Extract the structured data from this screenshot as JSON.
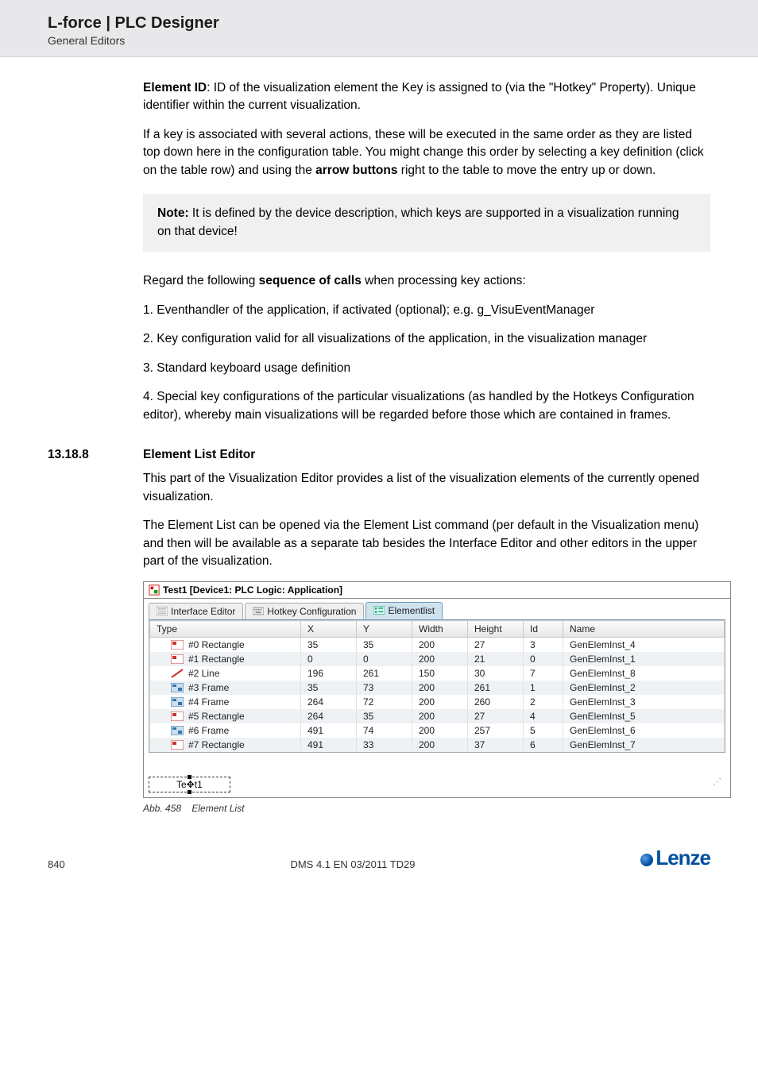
{
  "header": {
    "title": "L-force | PLC Designer",
    "subtitle": "General Editors"
  },
  "para": {
    "p1a": "Element ID",
    "p1b": ": ID of the visualization element the Key is assigned to (via the \"Hotkey\" Property). Unique identifier within the current visualization.",
    "p2a": "If a key is associated with several actions, these will be executed in the same order as they are listed top down here in the configuration table. You might change this order by selecting a key definition (click on the table row) and using the ",
    "p2b": "arrow buttons",
    "p2c": " right to the table to move the entry up or down.",
    "note_a": "Note:",
    "note_b": " It is defined by the device description, which keys are supported in a visualization running on that device!",
    "p3a": "Regard the following ",
    "p3b": "sequence of calls",
    "p3c": " when processing key actions:",
    "li1": "1. Eventhandler of the application, if activated (optional); e.g. g_VisuEventManager",
    "li2": "2. Key configuration valid for all visualizations of the application, in the visualization manager",
    "li3": "3. Standard keyboard usage definition",
    "li4": "4. Special key configurations of the particular visualizations (as handled by the Hotkeys Configuration editor), whereby main visualizations will be regarded before those which are contained in frames."
  },
  "section": {
    "num": "13.18.8",
    "title": "Element List Editor",
    "p1": "This part of the Visualization Editor provides a list of the visualization elements of the currently opened visualization.",
    "p2": "The Element List can be opened via the Element List command (per default in the Visualization menu) and then will be available as a separate tab besides the Interface Editor and other editors in the upper part of the visualization."
  },
  "screenshot": {
    "window_title": "Test1 [Device1: PLC Logic: Application]",
    "tabs": {
      "t1": "Interface Editor",
      "t2": "Hotkey Configuration",
      "t3": "Elementlist"
    },
    "cols": {
      "c0": "Type",
      "c1": "X",
      "c2": "Y",
      "c3": "Width",
      "c4": "Height",
      "c5": "Id",
      "c6": "Name"
    },
    "rows": [
      {
        "type": "#0 Rectangle",
        "icon": "rect",
        "x": "35",
        "y": "35",
        "w": "200",
        "h": "27",
        "id": "3",
        "name": "GenElemInst_4"
      },
      {
        "type": "#1 Rectangle",
        "icon": "rect",
        "x": "0",
        "y": "0",
        "w": "200",
        "h": "21",
        "id": "0",
        "name": "GenElemInst_1"
      },
      {
        "type": "#2 Line",
        "icon": "line",
        "x": "196",
        "y": "261",
        "w": "150",
        "h": "30",
        "id": "7",
        "name": "GenElemInst_8"
      },
      {
        "type": "#3 Frame",
        "icon": "frame",
        "x": "35",
        "y": "73",
        "w": "200",
        "h": "261",
        "id": "1",
        "name": "GenElemInst_2"
      },
      {
        "type": "#4 Frame",
        "icon": "frame",
        "x": "264",
        "y": "72",
        "w": "200",
        "h": "260",
        "id": "2",
        "name": "GenElemInst_3"
      },
      {
        "type": "#5 Rectangle",
        "icon": "rect",
        "x": "264",
        "y": "35",
        "w": "200",
        "h": "27",
        "id": "4",
        "name": "GenElemInst_5"
      },
      {
        "type": "#6 Frame",
        "icon": "frame",
        "x": "491",
        "y": "74",
        "w": "200",
        "h": "257",
        "id": "5",
        "name": "GenElemInst_6"
      },
      {
        "type": "#7 Rectangle",
        "icon": "rect",
        "x": "491",
        "y": "33",
        "w": "200",
        "h": "37",
        "id": "6",
        "name": "GenElemInst_7"
      }
    ],
    "handle_text": "Te✥t1",
    "grip": "⋰"
  },
  "caption": {
    "pre": "Abb. 458",
    "txt": "Element List"
  },
  "footer": {
    "page": "840",
    "center": "DMS 4.1 EN 03/2011 TD29",
    "logo": "Lenze"
  }
}
